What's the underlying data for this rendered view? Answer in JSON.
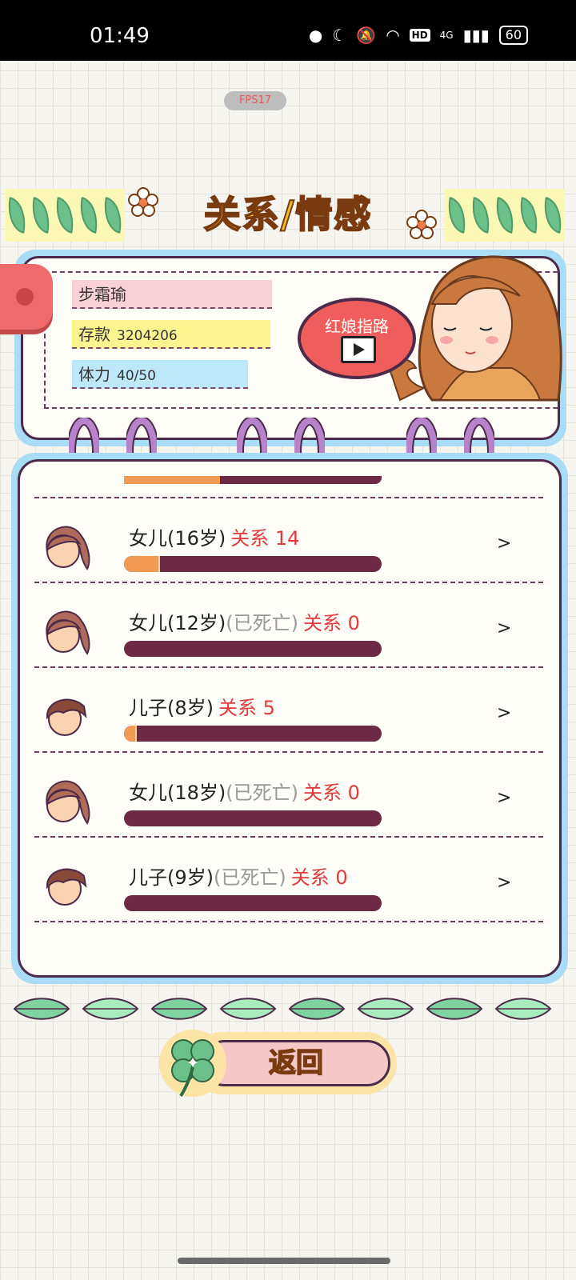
{
  "status": {
    "time": "01:49",
    "battery": "60",
    "hd": "HD",
    "net": "4G"
  },
  "fps": "FPS17",
  "title": "关系/情感",
  "profile": {
    "name": "步霜瑜",
    "savings_label": "存款",
    "savings": "3204206",
    "stamina_label": "体力",
    "stamina": "40/50"
  },
  "guide_label": "红娘指路",
  "relations": [
    {
      "name": "女儿(16岁)",
      "dead": "",
      "rel_label": "关系",
      "rel": "14",
      "fill": 0.14
    },
    {
      "name": "女儿(12岁)",
      "dead": "(已死亡)",
      "rel_label": "关系",
      "rel": "0",
      "fill": 0.0
    },
    {
      "name": "儿子(8岁)",
      "dead": "",
      "rel_label": "关系",
      "rel": "5",
      "fill": 0.05
    },
    {
      "name": "女儿(18岁)",
      "dead": "(已死亡)",
      "rel_label": "关系",
      "rel": "0",
      "fill": 0.0
    },
    {
      "name": "儿子(9岁)",
      "dead": "(已死亡)",
      "rel_label": "关系",
      "rel": "0",
      "fill": 0.0
    }
  ],
  "back_label": "返回",
  "colors": {
    "accent": "#f2bf2b",
    "relation": "#e23a3a",
    "bar": "#6e2a44",
    "bar_fill": "#f19a55"
  }
}
